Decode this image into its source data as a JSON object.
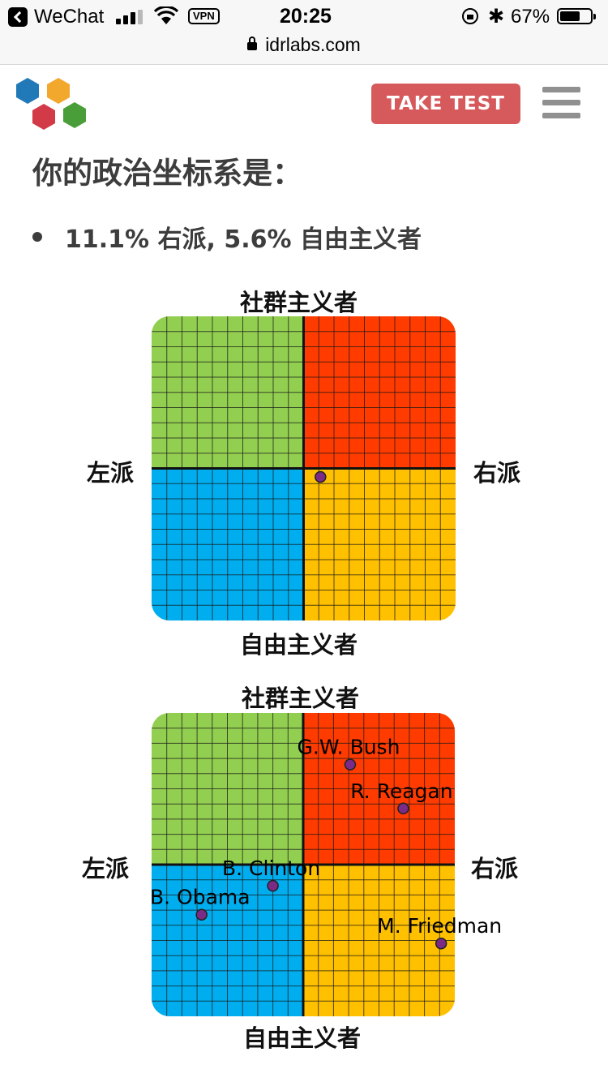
{
  "status_bar": {
    "back_app": "WeChat",
    "network": "VPN",
    "time": "20:25",
    "battery_percent_text": "67%",
    "battery_level": 0.67,
    "signal_bars": 3
  },
  "url_bar": {
    "domain": "idrlabs.com"
  },
  "header": {
    "logo_colors": [
      "#2179b8",
      "#f2a72d",
      "#d33a48",
      "#4a9e3a"
    ],
    "take_test_label": "TAKE TEST",
    "take_test_color": "#d65a5c"
  },
  "result": {
    "heading": "你的政治坐标系是：",
    "items": [
      "11.1% 右派, 5.6% 自由主义者"
    ]
  },
  "quadrant_colors": {
    "top_left": "#92cf50",
    "top_right": "#ff3b00",
    "bottom_left": "#00aeef",
    "bottom_right": "#ffc000",
    "marker": "#7b2a86"
  },
  "chart_data": [
    {
      "type": "scatter",
      "labels": {
        "top": "社群主义者",
        "bottom": "自由主义者",
        "left": "左派",
        "right": "右派"
      },
      "xlim": [
        -100,
        100
      ],
      "ylim": [
        -100,
        100
      ],
      "grid": true,
      "points": [
        {
          "label": "",
          "x": 11.1,
          "y": -5.6
        }
      ]
    },
    {
      "type": "scatter",
      "labels": {
        "top": "社群主义者",
        "bottom": "自由主义者",
        "left": "左派",
        "right": "右派"
      },
      "xlim": [
        -100,
        100
      ],
      "ylim": [
        -100,
        100
      ],
      "grid": true,
      "points": [
        {
          "label": "G.W. Bush",
          "x": 31,
          "y": 66
        },
        {
          "label": "R. Reagan",
          "x": 66,
          "y": 37
        },
        {
          "label": "B. Clinton",
          "x": -20,
          "y": -14
        },
        {
          "label": "B. Obama",
          "x": -67,
          "y": -33
        },
        {
          "label": "M. Friedman",
          "x": 91,
          "y": -52
        }
      ]
    }
  ]
}
